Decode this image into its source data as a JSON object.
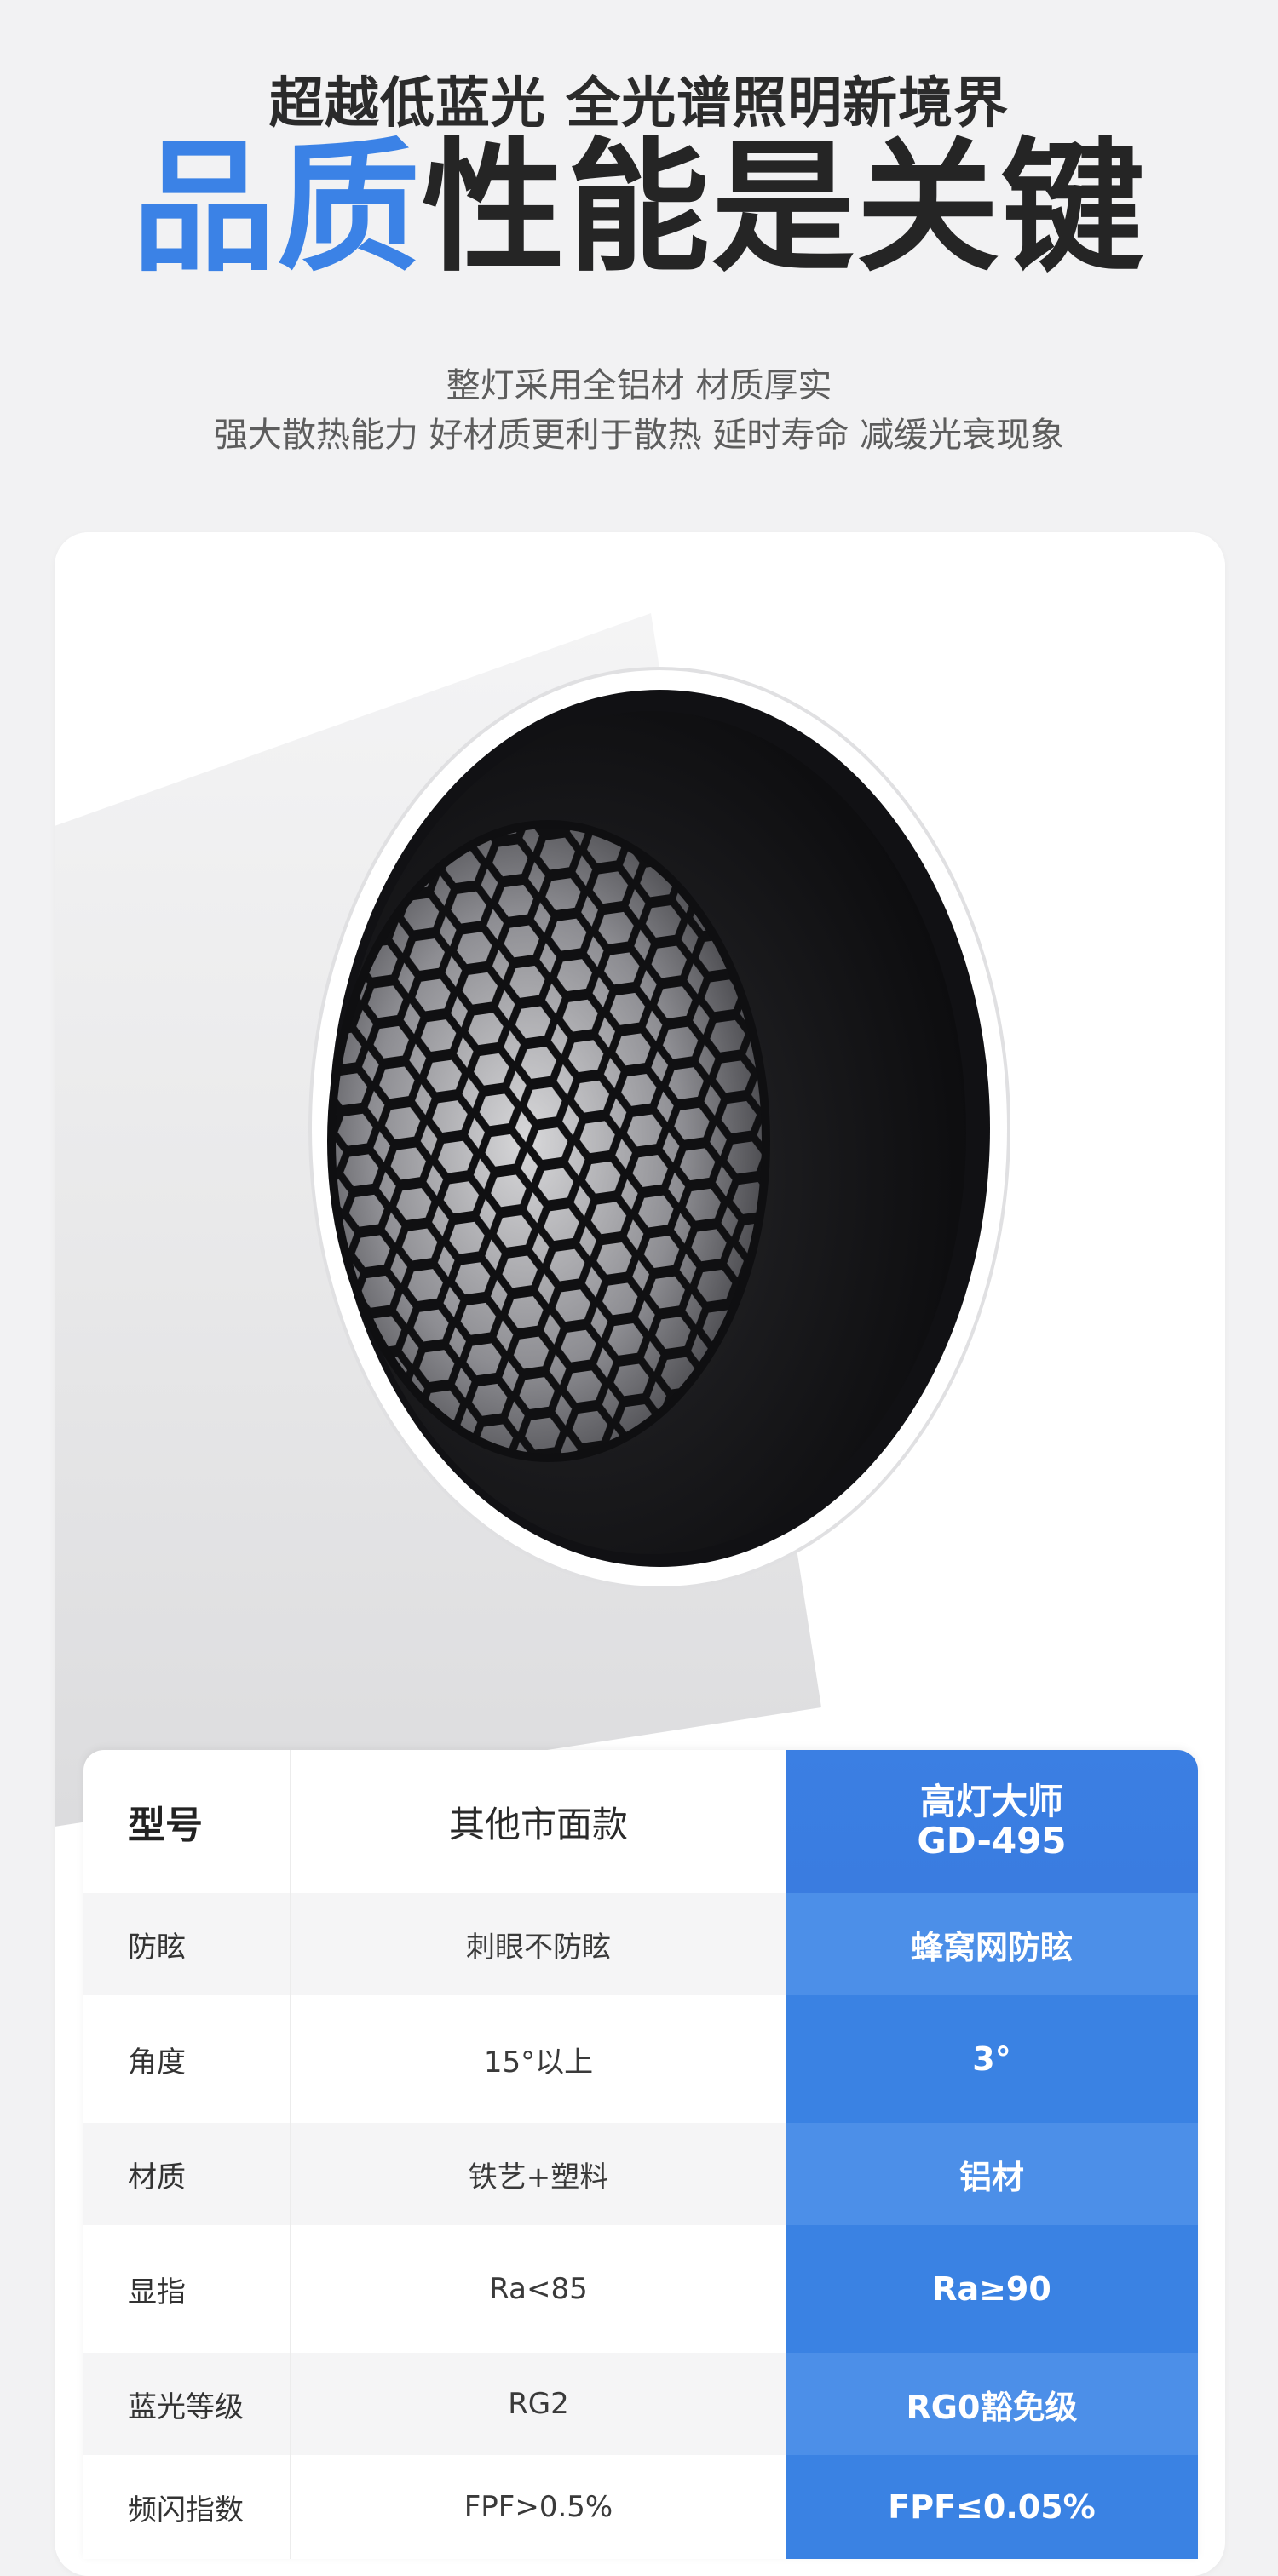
{
  "hero": {
    "subtitle": "超越低蓝光 全光谱照明新境界",
    "headline_blue": "品质",
    "headline_dark": "性能是关键",
    "desc_line1": "整灯采用全铝材 材质厚实",
    "desc_line2": "强大散热能力 好材质更利于散热 延时寿命 减缓光衰现象"
  },
  "colors": {
    "accent": "#3b82e6",
    "background": "#f2f2f3"
  },
  "product": {
    "icon": "honeycomb-spotlight"
  },
  "comparison": {
    "header": {
      "label": "型号",
      "other": "其他市面款",
      "ours_line1": "高灯大师",
      "ours_line2": "GD-495"
    },
    "rows": [
      {
        "label": "防眩",
        "other": "刺眼不防眩",
        "ours": "蜂窝网防眩"
      },
      {
        "label": "角度",
        "other": "15°以上",
        "ours": "3°"
      },
      {
        "label": "材质",
        "other": "铁艺+塑料",
        "ours": "铝材"
      },
      {
        "label": "显指",
        "other": "Ra<85",
        "ours": "Ra≥90"
      },
      {
        "label": "蓝光等级",
        "other": "RG2",
        "ours": "RG0豁免级"
      },
      {
        "label": "频闪指数",
        "other": "FPF>0.5%",
        "ours": "FPF≤0.05%"
      }
    ]
  }
}
